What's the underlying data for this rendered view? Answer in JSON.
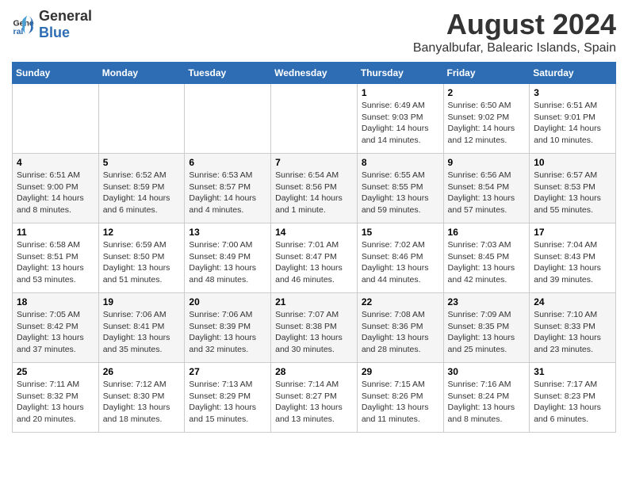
{
  "header": {
    "logo_general": "General",
    "logo_blue": "Blue",
    "month_title": "August 2024",
    "location": "Banyalbufar, Balearic Islands, Spain"
  },
  "calendar": {
    "weekdays": [
      "Sunday",
      "Monday",
      "Tuesday",
      "Wednesday",
      "Thursday",
      "Friday",
      "Saturday"
    ],
    "weeks": [
      [
        {
          "day": "",
          "content": ""
        },
        {
          "day": "",
          "content": ""
        },
        {
          "day": "",
          "content": ""
        },
        {
          "day": "",
          "content": ""
        },
        {
          "day": "1",
          "content": "Sunrise: 6:49 AM\nSunset: 9:03 PM\nDaylight: 14 hours and 14 minutes."
        },
        {
          "day": "2",
          "content": "Sunrise: 6:50 AM\nSunset: 9:02 PM\nDaylight: 14 hours and 12 minutes."
        },
        {
          "day": "3",
          "content": "Sunrise: 6:51 AM\nSunset: 9:01 PM\nDaylight: 14 hours and 10 minutes."
        }
      ],
      [
        {
          "day": "4",
          "content": "Sunrise: 6:51 AM\nSunset: 9:00 PM\nDaylight: 14 hours and 8 minutes."
        },
        {
          "day": "5",
          "content": "Sunrise: 6:52 AM\nSunset: 8:59 PM\nDaylight: 14 hours and 6 minutes."
        },
        {
          "day": "6",
          "content": "Sunrise: 6:53 AM\nSunset: 8:57 PM\nDaylight: 14 hours and 4 minutes."
        },
        {
          "day": "7",
          "content": "Sunrise: 6:54 AM\nSunset: 8:56 PM\nDaylight: 14 hours and 1 minute."
        },
        {
          "day": "8",
          "content": "Sunrise: 6:55 AM\nSunset: 8:55 PM\nDaylight: 13 hours and 59 minutes."
        },
        {
          "day": "9",
          "content": "Sunrise: 6:56 AM\nSunset: 8:54 PM\nDaylight: 13 hours and 57 minutes."
        },
        {
          "day": "10",
          "content": "Sunrise: 6:57 AM\nSunset: 8:53 PM\nDaylight: 13 hours and 55 minutes."
        }
      ],
      [
        {
          "day": "11",
          "content": "Sunrise: 6:58 AM\nSunset: 8:51 PM\nDaylight: 13 hours and 53 minutes."
        },
        {
          "day": "12",
          "content": "Sunrise: 6:59 AM\nSunset: 8:50 PM\nDaylight: 13 hours and 51 minutes."
        },
        {
          "day": "13",
          "content": "Sunrise: 7:00 AM\nSunset: 8:49 PM\nDaylight: 13 hours and 48 minutes."
        },
        {
          "day": "14",
          "content": "Sunrise: 7:01 AM\nSunset: 8:47 PM\nDaylight: 13 hours and 46 minutes."
        },
        {
          "day": "15",
          "content": "Sunrise: 7:02 AM\nSunset: 8:46 PM\nDaylight: 13 hours and 44 minutes."
        },
        {
          "day": "16",
          "content": "Sunrise: 7:03 AM\nSunset: 8:45 PM\nDaylight: 13 hours and 42 minutes."
        },
        {
          "day": "17",
          "content": "Sunrise: 7:04 AM\nSunset: 8:43 PM\nDaylight: 13 hours and 39 minutes."
        }
      ],
      [
        {
          "day": "18",
          "content": "Sunrise: 7:05 AM\nSunset: 8:42 PM\nDaylight: 13 hours and 37 minutes."
        },
        {
          "day": "19",
          "content": "Sunrise: 7:06 AM\nSunset: 8:41 PM\nDaylight: 13 hours and 35 minutes."
        },
        {
          "day": "20",
          "content": "Sunrise: 7:06 AM\nSunset: 8:39 PM\nDaylight: 13 hours and 32 minutes."
        },
        {
          "day": "21",
          "content": "Sunrise: 7:07 AM\nSunset: 8:38 PM\nDaylight: 13 hours and 30 minutes."
        },
        {
          "day": "22",
          "content": "Sunrise: 7:08 AM\nSunset: 8:36 PM\nDaylight: 13 hours and 28 minutes."
        },
        {
          "day": "23",
          "content": "Sunrise: 7:09 AM\nSunset: 8:35 PM\nDaylight: 13 hours and 25 minutes."
        },
        {
          "day": "24",
          "content": "Sunrise: 7:10 AM\nSunset: 8:33 PM\nDaylight: 13 hours and 23 minutes."
        }
      ],
      [
        {
          "day": "25",
          "content": "Sunrise: 7:11 AM\nSunset: 8:32 PM\nDaylight: 13 hours and 20 minutes."
        },
        {
          "day": "26",
          "content": "Sunrise: 7:12 AM\nSunset: 8:30 PM\nDaylight: 13 hours and 18 minutes."
        },
        {
          "day": "27",
          "content": "Sunrise: 7:13 AM\nSunset: 8:29 PM\nDaylight: 13 hours and 15 minutes."
        },
        {
          "day": "28",
          "content": "Sunrise: 7:14 AM\nSunset: 8:27 PM\nDaylight: 13 hours and 13 minutes."
        },
        {
          "day": "29",
          "content": "Sunrise: 7:15 AM\nSunset: 8:26 PM\nDaylight: 13 hours and 11 minutes."
        },
        {
          "day": "30",
          "content": "Sunrise: 7:16 AM\nSunset: 8:24 PM\nDaylight: 13 hours and 8 minutes."
        },
        {
          "day": "31",
          "content": "Sunrise: 7:17 AM\nSunset: 8:23 PM\nDaylight: 13 hours and 6 minutes."
        }
      ]
    ]
  }
}
